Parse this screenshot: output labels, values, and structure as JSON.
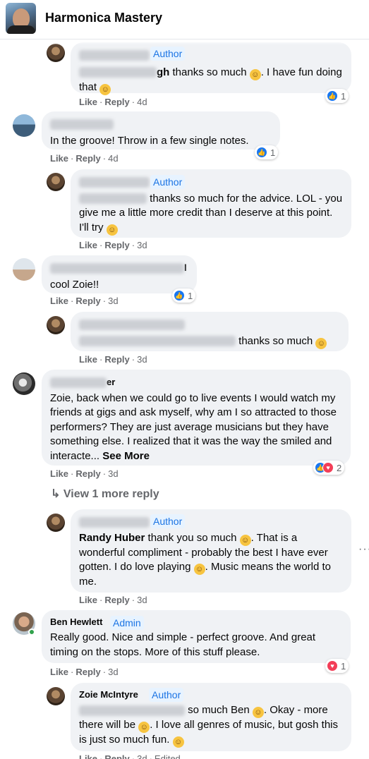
{
  "header": {
    "title": "Harmonica Mastery",
    "logo_icon": "group-cover-photo"
  },
  "labels": {
    "author": "Author",
    "admin": "Admin",
    "like": "Like",
    "reply": "Reply",
    "see_more": "See More",
    "view_more": "View 1 more reply",
    "edited": "Edited"
  },
  "comments": [
    {
      "author": "Zoie McIntyre",
      "badge": "Author",
      "text_before": "gh",
      "text": " thanks so much",
      "text2": ". I have fun doing that",
      "time": "4d",
      "reactions": "1"
    },
    {
      "author": "Michael Putt",
      "text": "In the groove! Throw in a few single notes.",
      "time": "4d",
      "reactions": "1"
    },
    {
      "author": "Zoie McIntyre",
      "badge": "Author",
      "text": "thanks so much for the advice. LOL - you give me a little more credit than I deserve at this point. I'll try",
      "time": "3d"
    },
    {
      "author": "Mary Beth Anderson",
      "text_tail": "l",
      "text": "cool Zoie!!",
      "time": "3d",
      "reactions": "1"
    },
    {
      "author": "Zoie McIntyre",
      "text": "thanks so much",
      "time": "3d"
    },
    {
      "author": "Randy Huber",
      "text_tail": "er",
      "text": "Zoie, back when we could go to live events I would watch my friends at gigs and ask myself, why am I so attracted to those performers? They are just average musicians but they have something else. I realized that it was the way the smiled and interacte...",
      "time": "3d",
      "reactions": "2"
    },
    {
      "author": "Zoie McIntyre",
      "badge": "Author",
      "mention": "Randy Huber",
      "text": " thank you so much",
      "text2": ". That is a wonderful compliment - probably the best I have ever gotten. I do love playing",
      "text3": ". Music means the world to me.",
      "time": "3d"
    },
    {
      "author": "Ben Hewlett",
      "badge": "Admin",
      "text": "Really good. Nice and simple - perfect groove. And great timing on the stops. More of this stuff please.",
      "time": "3d",
      "reactions": "1"
    },
    {
      "author": "Zoie McIntyre",
      "badge": "Author",
      "text": "so much Ben",
      "text2": ". Okay - more there will be",
      "text3": ". I love all genres of music, but gosh this is just so much fun.",
      "time": "3d"
    }
  ],
  "colors": {
    "bubble": "#f0f2f5",
    "meta": "#65676b",
    "accent": "#1877f2",
    "love": "#f33e58",
    "online": "#31a24c"
  }
}
